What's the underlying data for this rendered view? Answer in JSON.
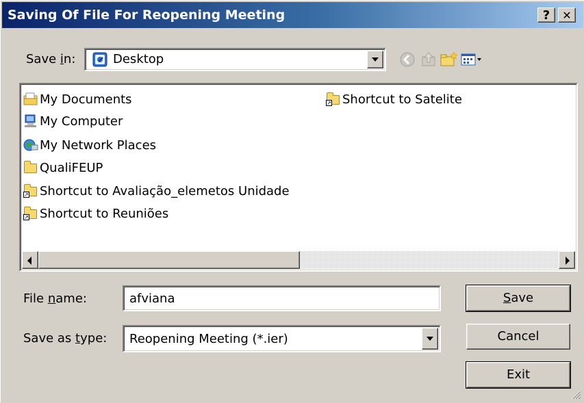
{
  "window": {
    "title": "Saving Of File For Reopening Meeting",
    "help_glyph": "?",
    "close_glyph": "✕"
  },
  "save_in": {
    "label_pre": "Save ",
    "label_accel": "i",
    "label_post": "n:",
    "value": "Desktop"
  },
  "files": [
    {
      "name": "My Documents",
      "icon": "my-documents-icon"
    },
    {
      "name": "My Computer",
      "icon": "my-computer-icon"
    },
    {
      "name": "My Network Places",
      "icon": "network-places-icon"
    },
    {
      "name": "QualiFEUP",
      "icon": "folder-icon"
    },
    {
      "name": "Shortcut to Avaliação_elemetos Unidade",
      "icon": "folder-shortcut-icon"
    },
    {
      "name": "Shortcut to Reuniões",
      "icon": "folder-shortcut-icon"
    },
    {
      "name": "Shortcut to Satelite",
      "icon": "folder-shortcut-icon"
    }
  ],
  "file_name": {
    "label_pre": "File ",
    "label_accel": "n",
    "label_post": "ame:",
    "value": "afviana"
  },
  "save_type": {
    "label_pre": "Save as ",
    "label_accel": "t",
    "label_post": "ype:",
    "value": "Reopening Meeting (*.ier)"
  },
  "buttons": {
    "save_accel": "S",
    "save_rest": "ave",
    "cancel": "Cancel",
    "exit": "Exit"
  },
  "colors": {
    "title_start": "#0a246a",
    "title_end": "#a6caf0",
    "face": "#d4d0c8"
  }
}
